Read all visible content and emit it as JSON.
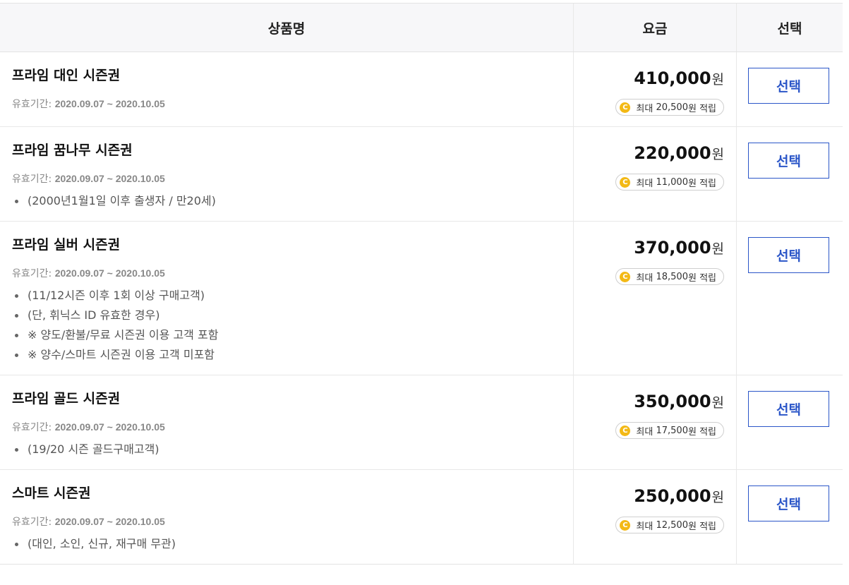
{
  "header": {
    "col_name": "상품명",
    "col_price": "요금",
    "col_select": "선택"
  },
  "labels": {
    "period_prefix": "유효기간:",
    "currency": "원",
    "point_prefix": "최대",
    "point_suffix": "원 적립",
    "select_button": "선택",
    "coin_glyph": "C"
  },
  "colors": {
    "accent": "#2b56c8",
    "coin": "#f3b916",
    "header_bg": "#f7f7f9"
  },
  "products": [
    {
      "name": "프라임 대인 시즌권",
      "period": "2020.09.07 ~ 2020.10.05",
      "notes": [],
      "price": "410,000",
      "point": "20,500"
    },
    {
      "name": "프라임 꿈나무 시즌권",
      "period": "2020.09.07 ~ 2020.10.05",
      "notes": [
        "(2000년1월1일 이후 출생자 / 만20세)"
      ],
      "price": "220,000",
      "point": "11,000"
    },
    {
      "name": "프라임 실버 시즌권",
      "period": "2020.09.07 ~ 2020.10.05",
      "notes": [
        "(11/12시즌 이후 1회 이상 구매고객)",
        "(단, 휘닉스 ID 유효한 경우)",
        "※ 양도/환불/무료 시즌권 이용 고객 포함",
        "※ 양수/스마트 시즌권 이용 고객 미포함"
      ],
      "price": "370,000",
      "point": "18,500"
    },
    {
      "name": "프라임 골드 시즌권",
      "period": "2020.09.07 ~ 2020.10.05",
      "notes": [
        "(19/20 시즌 골드구매고객)"
      ],
      "price": "350,000",
      "point": "17,500"
    },
    {
      "name": "스마트 시즌권",
      "period": "2020.09.07 ~ 2020.10.05",
      "notes": [
        "(대인, 소인, 신규, 재구매 무관)"
      ],
      "price": "250,000",
      "point": "12,500"
    }
  ]
}
